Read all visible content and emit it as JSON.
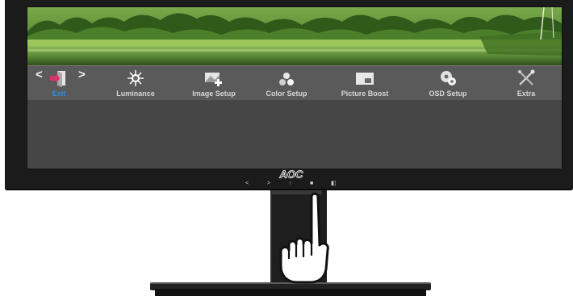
{
  "monitor": {
    "brand_logo": "AOC"
  },
  "osd": {
    "left_arrow": "<",
    "right_arrow": ">",
    "items": [
      {
        "label": "Exit",
        "icon": "exit-door-icon",
        "active": true
      },
      {
        "label": "Luminance",
        "icon": "sun-brightness-icon",
        "active": false
      },
      {
        "label": "Image Setup",
        "icon": "image-setup-icon",
        "active": false
      },
      {
        "label": "Color Setup",
        "icon": "color-dots-icon",
        "active": false
      },
      {
        "label": "Picture Boost",
        "icon": "picture-boost-icon",
        "active": false
      },
      {
        "label": "OSD Setup",
        "icon": "osd-gear-icon",
        "active": false
      },
      {
        "label": "Extra",
        "icon": "extra-tools-icon",
        "active": false
      }
    ],
    "colors": {
      "active_label": "#2d8fe0",
      "label": "#d6d6d6",
      "bar": "#5a5a5a",
      "exit_accent": "#e0306a"
    }
  },
  "bezel_buttons": [
    {
      "glyph": "<",
      "name": "left"
    },
    {
      "glyph": ">",
      "name": "right"
    },
    {
      "glyph": "↑",
      "name": "up"
    },
    {
      "glyph": "■",
      "name": "source"
    },
    {
      "glyph": "◧",
      "name": "menu"
    }
  ]
}
